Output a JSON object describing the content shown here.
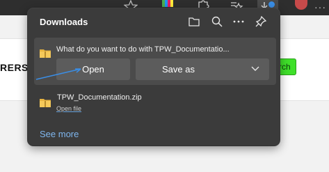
{
  "browser": {
    "toolbar_color": "#2e2e2e",
    "icons": [
      "star-icon",
      "extension-icon",
      "puzzle-icon",
      "favorites-icon",
      "downloads-icon",
      "profile-avatar",
      "more-icon"
    ]
  },
  "page": {
    "partial_text": "RERS",
    "green_button_text": "rch",
    "green_color": "#3fe02a"
  },
  "downloads": {
    "title": "Downloads",
    "header_icons": [
      "folder-icon",
      "search-icon",
      "more-icon",
      "pin-icon"
    ],
    "active_item": {
      "prompt": "What do you want to do with TPW_Documentatio...",
      "open_label": "Open",
      "save_as_label": "Save as"
    },
    "completed_item": {
      "file_name": "TPW_Documentation.zip",
      "action_link": "Open file"
    },
    "see_more": "See more",
    "link_color": "#7fb6ee"
  }
}
